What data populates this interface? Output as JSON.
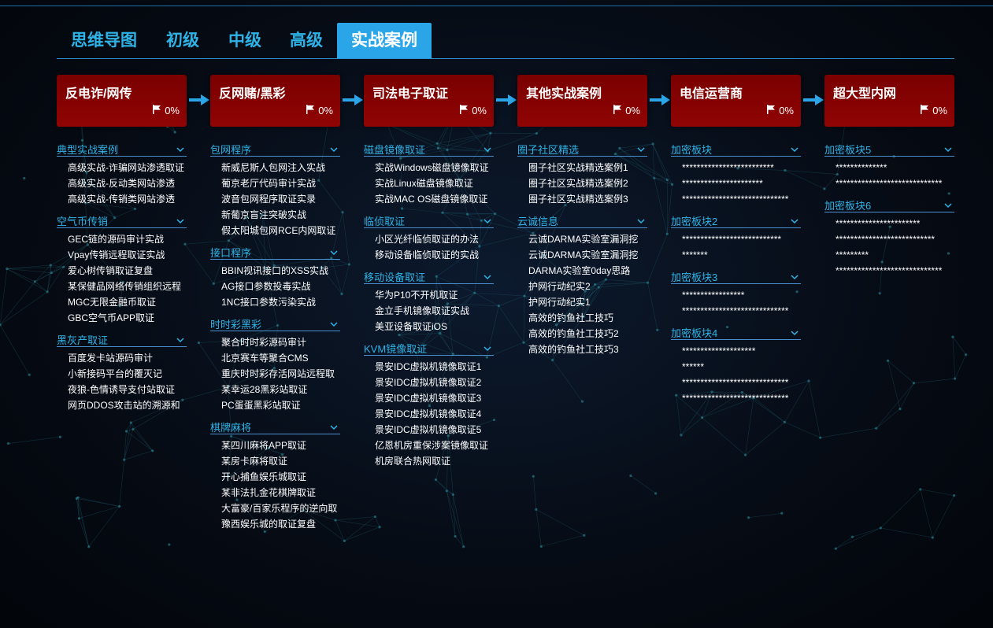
{
  "tabs": [
    {
      "label": "思维导图",
      "active": false
    },
    {
      "label": "初级",
      "active": false
    },
    {
      "label": "中级",
      "active": false
    },
    {
      "label": "高级",
      "active": false
    },
    {
      "label": "实战案例",
      "active": true
    }
  ],
  "colors": {
    "accent": "#2fb3e6",
    "tab_active": "#2aa6e8",
    "card_bg": "#8b0000",
    "arrow": "#2aa6e8"
  },
  "columns": [
    {
      "title": "反电诈/网传",
      "progress": "0%",
      "sections": [
        {
          "title": "典型实战案例",
          "items": [
            "高级实战-诈骗网站渗透取证",
            "高级实战-反动类网站渗透",
            "高级实战-传销类网站渗透"
          ]
        },
        {
          "title": "空气币传销",
          "items": [
            "GEC链的源码审计实战",
            "Vpay传销远程取证实战",
            "爱心树传销取证复盘",
            "某保健品网络传销组织远程",
            "MGC无限金融币取证",
            "GBC空气币APP取证"
          ]
        },
        {
          "title": "黑灰产取证",
          "items": [
            "百度发卡站源码审计",
            "小新接码平台的覆灭记",
            "夜狼-色情诱导支付站取证",
            "网页DDOS攻击站的溯源和"
          ]
        }
      ]
    },
    {
      "title": "反网赌/黑彩",
      "progress": "0%",
      "sections": [
        {
          "title": "包网程序",
          "items": [
            "新威尼斯人包网注入实战",
            "葡京老厅代码审计实战",
            "波音包网程序取证实录",
            "新葡京盲注突破实战",
            "假太阳城包网RCE内网取证"
          ]
        },
        {
          "title": "接口程序",
          "items": [
            "BBIN视讯接口的XSS实战",
            "AG接口参数投毒实战",
            "1NC接口参数污染实战"
          ]
        },
        {
          "title": "时时彩黑彩",
          "items": [
            "聚合时时彩源码审计",
            "北京赛车等聚合CMS",
            "重庆时时彩存活网站远程取",
            "某幸运28黑彩站取证",
            "PC蛋蛋黑彩站取证"
          ]
        },
        {
          "title": "棋牌麻将",
          "items": [
            "某四川麻将APP取证",
            "某房卡麻将取证",
            "开心捕鱼娱乐城取证",
            "某非法扎金花棋牌取证",
            "大富豪/百家乐程序的逆向取",
            "豫西娱乐城的取证复盘"
          ]
        }
      ]
    },
    {
      "title": "司法电子取证",
      "progress": "0%",
      "sections": [
        {
          "title": "磁盘镜像取证",
          "items": [
            "实战Windows磁盘镜像取证",
            "实战Linux磁盘镜像取证",
            "实战MAC OS磁盘镜像取证"
          ]
        },
        {
          "title": "临侦取证",
          "items": [
            "小区光纤临侦取证的办法",
            "移动设备临侦取证的实战"
          ]
        },
        {
          "title": "移动设备取证",
          "items": [
            "华为P10不开机取证",
            "金立手机镜像取证实战",
            "美亚设备取证iOS"
          ]
        },
        {
          "title": "KVM镜像取证",
          "items": [
            "景安IDC虚拟机镜像取证1",
            "景安IDC虚拟机镜像取证2",
            "景安IDC虚拟机镜像取证3",
            "景安IDC虚拟机镜像取证4",
            "景安IDC虚拟机镜像取证5",
            "亿恩机房重保涉案镜像取证",
            "机房联合热网取证"
          ]
        }
      ]
    },
    {
      "title": "其他实战案例",
      "progress": "0%",
      "sections": [
        {
          "title": "圈子社区精选",
          "items": [
            "圈子社区实战精选案例1",
            "圈子社区实战精选案例2",
            "圈子社区实战精选案例3"
          ]
        },
        {
          "title": "云诚信息",
          "items": [
            "云诚DARMA实验室漏洞挖",
            "云诚DARMA实验室漏洞挖",
            "DARMA实验室0day思路",
            "护网行动纪实2",
            "护网行动纪实1",
            "高效的钓鱼社工技巧",
            "高效的钓鱼社工技巧2",
            "高效的钓鱼社工技巧3"
          ]
        }
      ]
    },
    {
      "title": "电信运营商",
      "progress": "0%",
      "sections": [
        {
          "title": "加密板块",
          "items": [
            "*************************",
            "**********************",
            "*****************************"
          ]
        },
        {
          "title": "加密板块2",
          "items": [
            "***************************",
            "*******"
          ]
        },
        {
          "title": "加密板块3",
          "items": [
            "*****************",
            "*****************************"
          ]
        },
        {
          "title": "加密板块4",
          "items": [
            "********************",
            "******",
            "*****************************",
            "*****************************"
          ]
        }
      ]
    },
    {
      "title": "超大型内网",
      "progress": "0%",
      "sections": [
        {
          "title": "加密板块5",
          "items": [
            "**************",
            "*****************************"
          ]
        },
        {
          "title": "加密板块6",
          "items": [
            "***********************",
            "***************************",
            "*********",
            "*****************************"
          ]
        }
      ]
    }
  ]
}
